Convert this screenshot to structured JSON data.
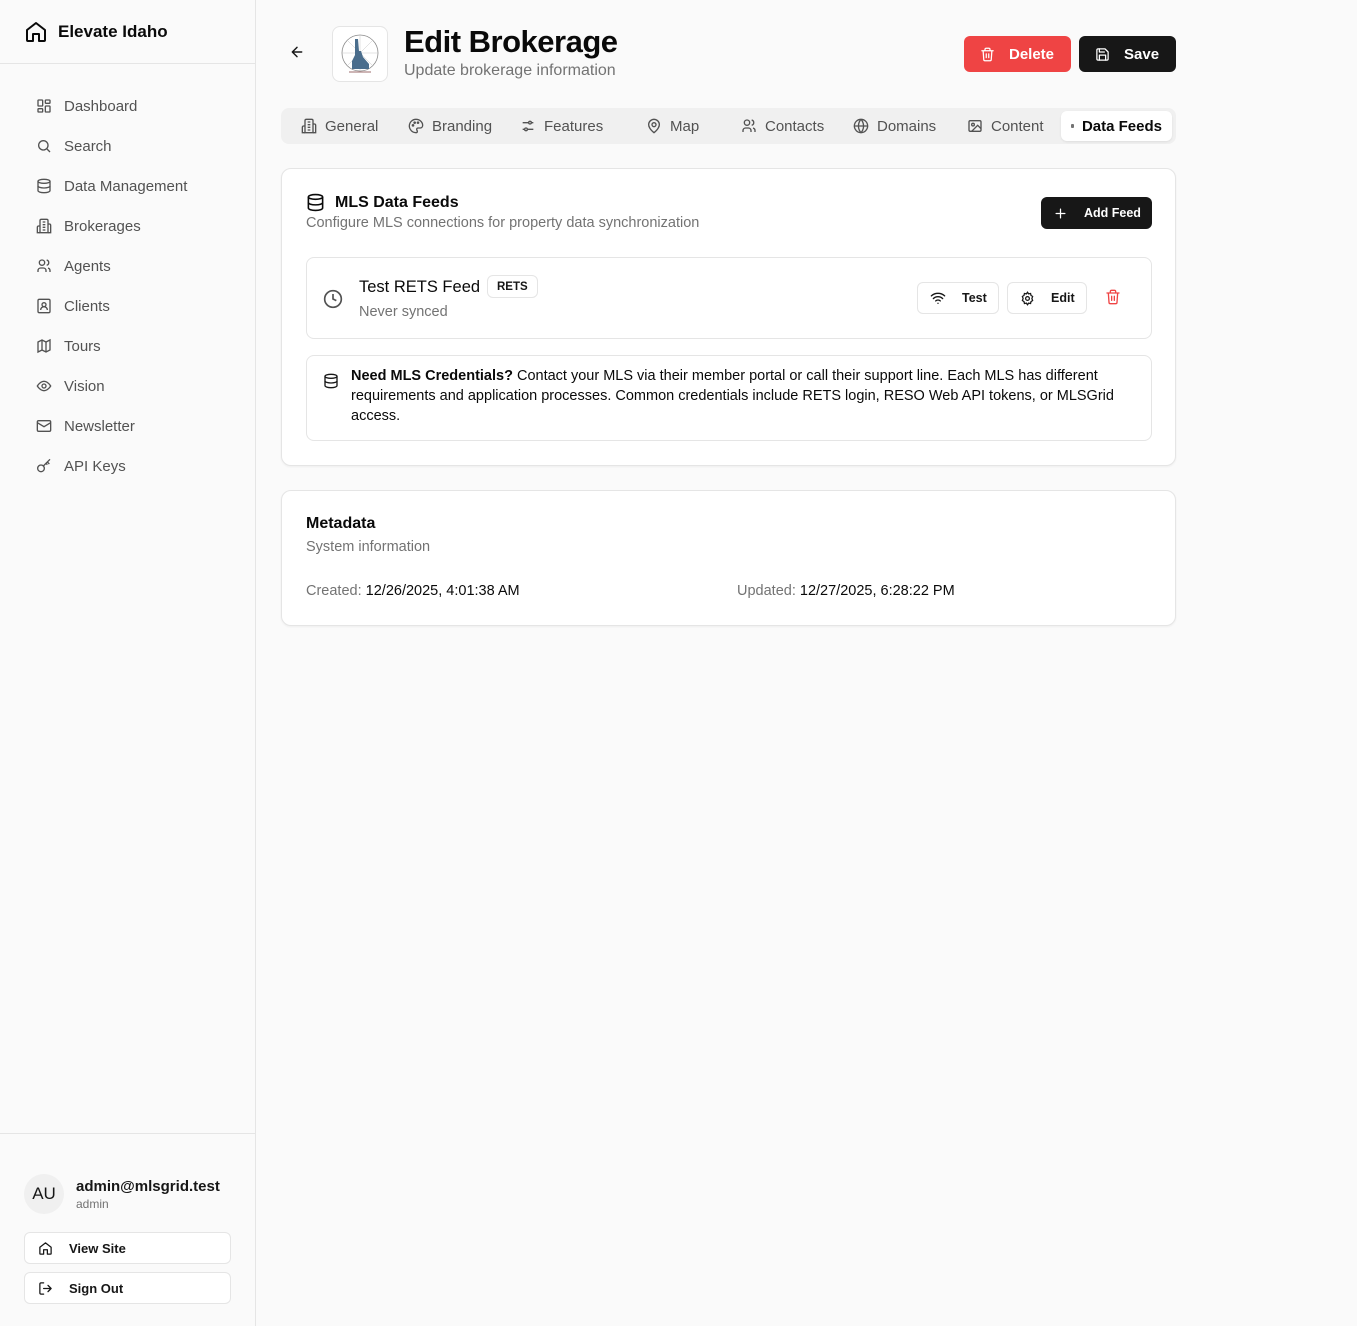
{
  "brand": {
    "name": "Elevate Idaho"
  },
  "nav": [
    {
      "label": "Dashboard",
      "icon": "dashboard-icon"
    },
    {
      "label": "Search",
      "icon": "search-icon"
    },
    {
      "label": "Data Management",
      "icon": "database-icon"
    },
    {
      "label": "Brokerages",
      "icon": "building-icon"
    },
    {
      "label": "Agents",
      "icon": "users-icon"
    },
    {
      "label": "Clients",
      "icon": "contact-icon"
    },
    {
      "label": "Tours",
      "icon": "map-icon"
    },
    {
      "label": "Vision",
      "icon": "eye-icon"
    },
    {
      "label": "Newsletter",
      "icon": "mail-icon"
    },
    {
      "label": "API Keys",
      "icon": "key-icon"
    }
  ],
  "user": {
    "initials": "AU",
    "email": "admin@mlsgrid.test",
    "role": "admin"
  },
  "footer": {
    "view_site": "View Site",
    "sign_out": "Sign Out"
  },
  "header": {
    "title": "Edit Brokerage",
    "subtitle": "Update brokerage information",
    "delete_label": "Delete",
    "save_label": "Save"
  },
  "tabs": [
    {
      "label": "General",
      "icon": "building-icon"
    },
    {
      "label": "Branding",
      "icon": "palette-icon"
    },
    {
      "label": "Features",
      "icon": "sliders-icon"
    },
    {
      "label": "Map",
      "icon": "map-pin-icon"
    },
    {
      "label": "Contacts",
      "icon": "users-icon"
    },
    {
      "label": "Domains",
      "icon": "globe-icon"
    },
    {
      "label": "Content",
      "icon": "image-icon"
    },
    {
      "label": "Data Feeds",
      "icon": "dot-icon",
      "active": true
    }
  ],
  "feeds_card": {
    "title": "MLS Data Feeds",
    "description": "Configure MLS connections for property data synchronization",
    "add_label": "Add Feed",
    "feed": {
      "name": "Test RETS Feed",
      "badge": "RETS",
      "status": "Never synced",
      "test_label": "Test",
      "edit_label": "Edit"
    },
    "info": {
      "bold": "Need MLS Credentials?",
      "text": " Contact your MLS via their member portal or call their support line. Each MLS has different requirements and application processes. Common credentials include RETS login, RESO Web API tokens, or MLSGrid access."
    }
  },
  "metadata": {
    "title": "Metadata",
    "description": "System information",
    "created_label": "Created:",
    "created_value": "12/26/2025, 4:01:38 AM",
    "updated_label": "Updated:",
    "updated_value": "12/27/2025, 6:28:22 PM"
  },
  "colors": {
    "danger": "#ef4444",
    "primary": "#171717",
    "muted": "#737373",
    "border": "#e5e5e5"
  }
}
